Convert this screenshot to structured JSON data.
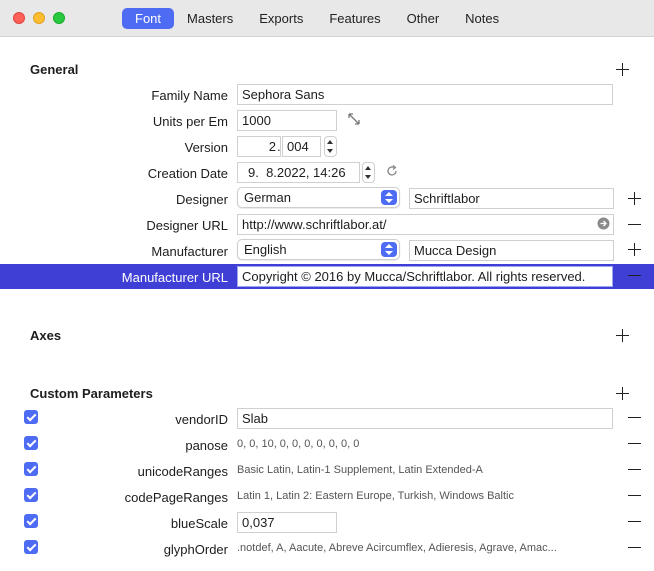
{
  "tabs": [
    {
      "label": "Font",
      "active": true
    },
    {
      "label": "Masters"
    },
    {
      "label": "Exports"
    },
    {
      "label": "Features"
    },
    {
      "label": "Other"
    },
    {
      "label": "Notes"
    }
  ],
  "general": {
    "title": "General",
    "family_name": {
      "label": "Family Name",
      "value": "Sephora Sans"
    },
    "units_per_em": {
      "label": "Units per Em",
      "value": "1000"
    },
    "version": {
      "label": "Version",
      "major": "2",
      "sep": ".",
      "minor": "004"
    },
    "creation_date": {
      "label": "Creation Date",
      "value": "9.  8.2022, 14:26"
    },
    "designer": {
      "label": "Designer",
      "language": "German",
      "value": "Schriftlabor"
    },
    "designer_url": {
      "label": "Designer URL",
      "value": "http://www.schriftlabor.at/"
    },
    "manufacturer": {
      "label": "Manufacturer",
      "language": "English",
      "value": "Mucca Design"
    },
    "manufacturer_url": {
      "label": "Manufacturer URL",
      "value": "Copyright © 2016 by Mucca/Schriftlabor. All rights reserved."
    }
  },
  "axes": {
    "title": "Axes"
  },
  "custom_parameters": {
    "title": "Custom Parameters",
    "items": [
      {
        "label": "vendorID",
        "value": "Slab",
        "checked": true
      },
      {
        "label": "panose",
        "value": "0, 0, 10, 0, 0, 0, 0, 0, 0, 0",
        "checked": true
      },
      {
        "label": "unicodeRanges",
        "value": "Basic Latin, Latin-1 Supplement, Latin Extended-A",
        "checked": true
      },
      {
        "label": "codePageRanges",
        "value": "Latin 1, Latin 2: Eastern Europe, Turkish, Windows Baltic",
        "checked": true
      },
      {
        "label": "blueScale",
        "value": "0,037",
        "checked": true
      },
      {
        "label": "glyphOrder",
        "value": ".notdef, A, Aacute, Abreve Acircumflex, Adieresis, Agrave, Amac...",
        "checked": true
      }
    ]
  },
  "colors": {
    "accent": "#4e6cf3",
    "selection": "#3f3fd6"
  }
}
